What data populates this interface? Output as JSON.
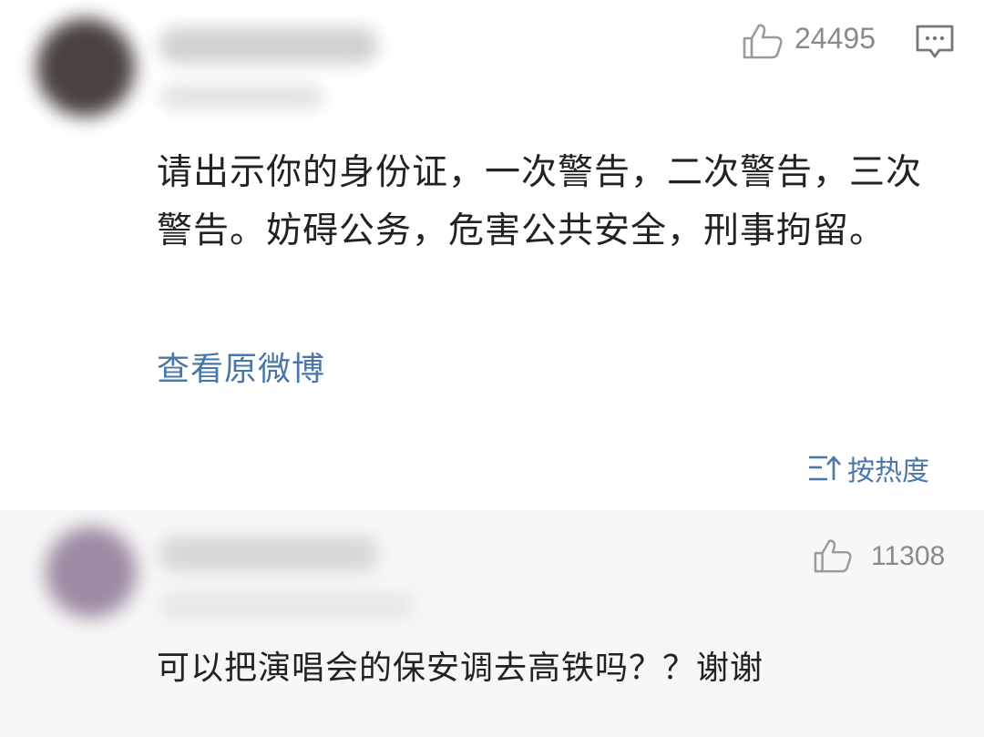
{
  "post": {
    "like_count": "24495",
    "text": "请出示你的身份证，一次警告，二次警告，三次警告。妨碍公务，危害公共安全，刑事拘留。",
    "view_original_label": "查看原微博",
    "icons": {
      "like": "thumbs-up-icon",
      "comment": "comment-icon"
    }
  },
  "sort": {
    "label": "按热度",
    "icon": "sort-icon"
  },
  "reply": {
    "like_count": "11308",
    "text": "可以把演唱会的保安调去高铁吗？？谢谢",
    "icons": {
      "like": "thumbs-up-icon"
    }
  },
  "colors": {
    "link": "#4a77a8",
    "muted": "#8a8a8a",
    "text": "#222222",
    "reply_bg": "#f7f7f7"
  }
}
